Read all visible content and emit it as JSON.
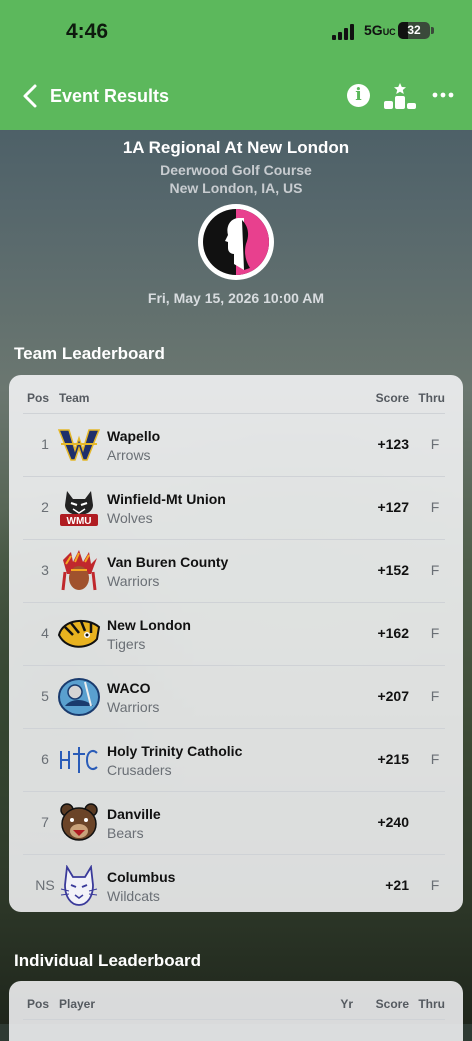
{
  "status": {
    "time": "4:46",
    "network": "5G",
    "network_suffix": "UC",
    "battery": "32"
  },
  "nav": {
    "back_label": "Event Results"
  },
  "event": {
    "title": "1A Regional At New London",
    "course": "Deerwood Golf Course",
    "location": "New London, IA, US",
    "date": "Fri, May 15, 2026 10:00 AM"
  },
  "team_leaderboard": {
    "title": "Team Leaderboard",
    "headers": {
      "pos": "Pos",
      "team": "Team",
      "score": "Score",
      "thru": "Thru"
    },
    "rows": [
      {
        "pos": "1",
        "name": "Wapello",
        "mascot": "Arrows",
        "score": "+123",
        "thru": "F",
        "logo": "wapello-logo"
      },
      {
        "pos": "2",
        "name": "Winfield-Mt Union",
        "mascot": "Wolves",
        "score": "+127",
        "thru": "F",
        "logo": "wmu-logo"
      },
      {
        "pos": "3",
        "name": "Van Buren County",
        "mascot": "Warriors",
        "score": "+152",
        "thru": "F",
        "logo": "warrior-logo"
      },
      {
        "pos": "4",
        "name": "New London",
        "mascot": "Tigers",
        "score": "+162",
        "thru": "F",
        "logo": "tiger-logo"
      },
      {
        "pos": "5",
        "name": "WACO",
        "mascot": "Warriors",
        "score": "+207",
        "thru": "F",
        "logo": "waco-logo"
      },
      {
        "pos": "6",
        "name": "Holy Trinity Catholic",
        "mascot": "Crusaders",
        "score": "+215",
        "thru": "F",
        "logo": "htc-logo"
      },
      {
        "pos": "7",
        "name": "Danville",
        "mascot": "Bears",
        "score": "+240",
        "thru": "",
        "logo": "bear-logo"
      },
      {
        "pos": "NS",
        "name": "Columbus",
        "mascot": "Wildcats",
        "score": "+21",
        "thru": "F",
        "logo": "wildcat-logo"
      }
    ]
  },
  "individual_leaderboard": {
    "title": "Individual Leaderboard",
    "headers": {
      "pos": "Pos",
      "player": "Player",
      "yr": "Yr",
      "score": "Score",
      "thru": "Thru"
    }
  }
}
